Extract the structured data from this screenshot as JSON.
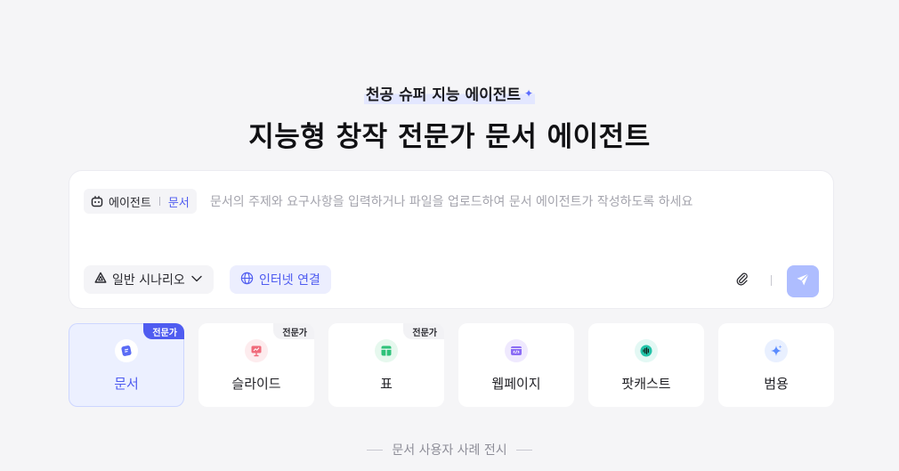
{
  "hero": {
    "tagline": "천공 슈퍼 지능 에이전트",
    "headline": "지능형 창작 전문가 문서 에이전트"
  },
  "composer": {
    "agent_label": "에이전트",
    "agent_type": "문서",
    "placeholder": "문서의 주제와 요구사항을 입력하거나 파일을 업로드하여 문서 에이전트가 작성하도록 하세요",
    "scenario_label": "일반 시나리오",
    "internet_label": "인터넷 연결"
  },
  "types": [
    {
      "label": "문서",
      "badge": "전문가",
      "active": true,
      "color": "#5b6cf5"
    },
    {
      "label": "슬라이드",
      "badge": "전문가",
      "active": false,
      "color": "#f06a7a"
    },
    {
      "label": "표",
      "badge": "전문가",
      "active": false,
      "color": "#2fc27a"
    },
    {
      "label": "웹페이지",
      "badge": "",
      "active": false,
      "color": "#8b6cf5"
    },
    {
      "label": "팟캐스트",
      "badge": "",
      "active": false,
      "color": "#22c3a8"
    },
    {
      "label": "범용",
      "badge": "",
      "active": false,
      "color": "#5b8cff"
    }
  ],
  "showcase_label": "문서 사용자 사례 전시",
  "colors": {
    "accent": "#4f5cf0",
    "send": "#aebdff",
    "background": "#f5f5f7"
  },
  "icons": [
    "sparkle-icon",
    "robot-icon",
    "triangle-scenario-icon",
    "chevron-down-icon",
    "globe-icon",
    "paperclip-icon",
    "send-icon"
  ]
}
